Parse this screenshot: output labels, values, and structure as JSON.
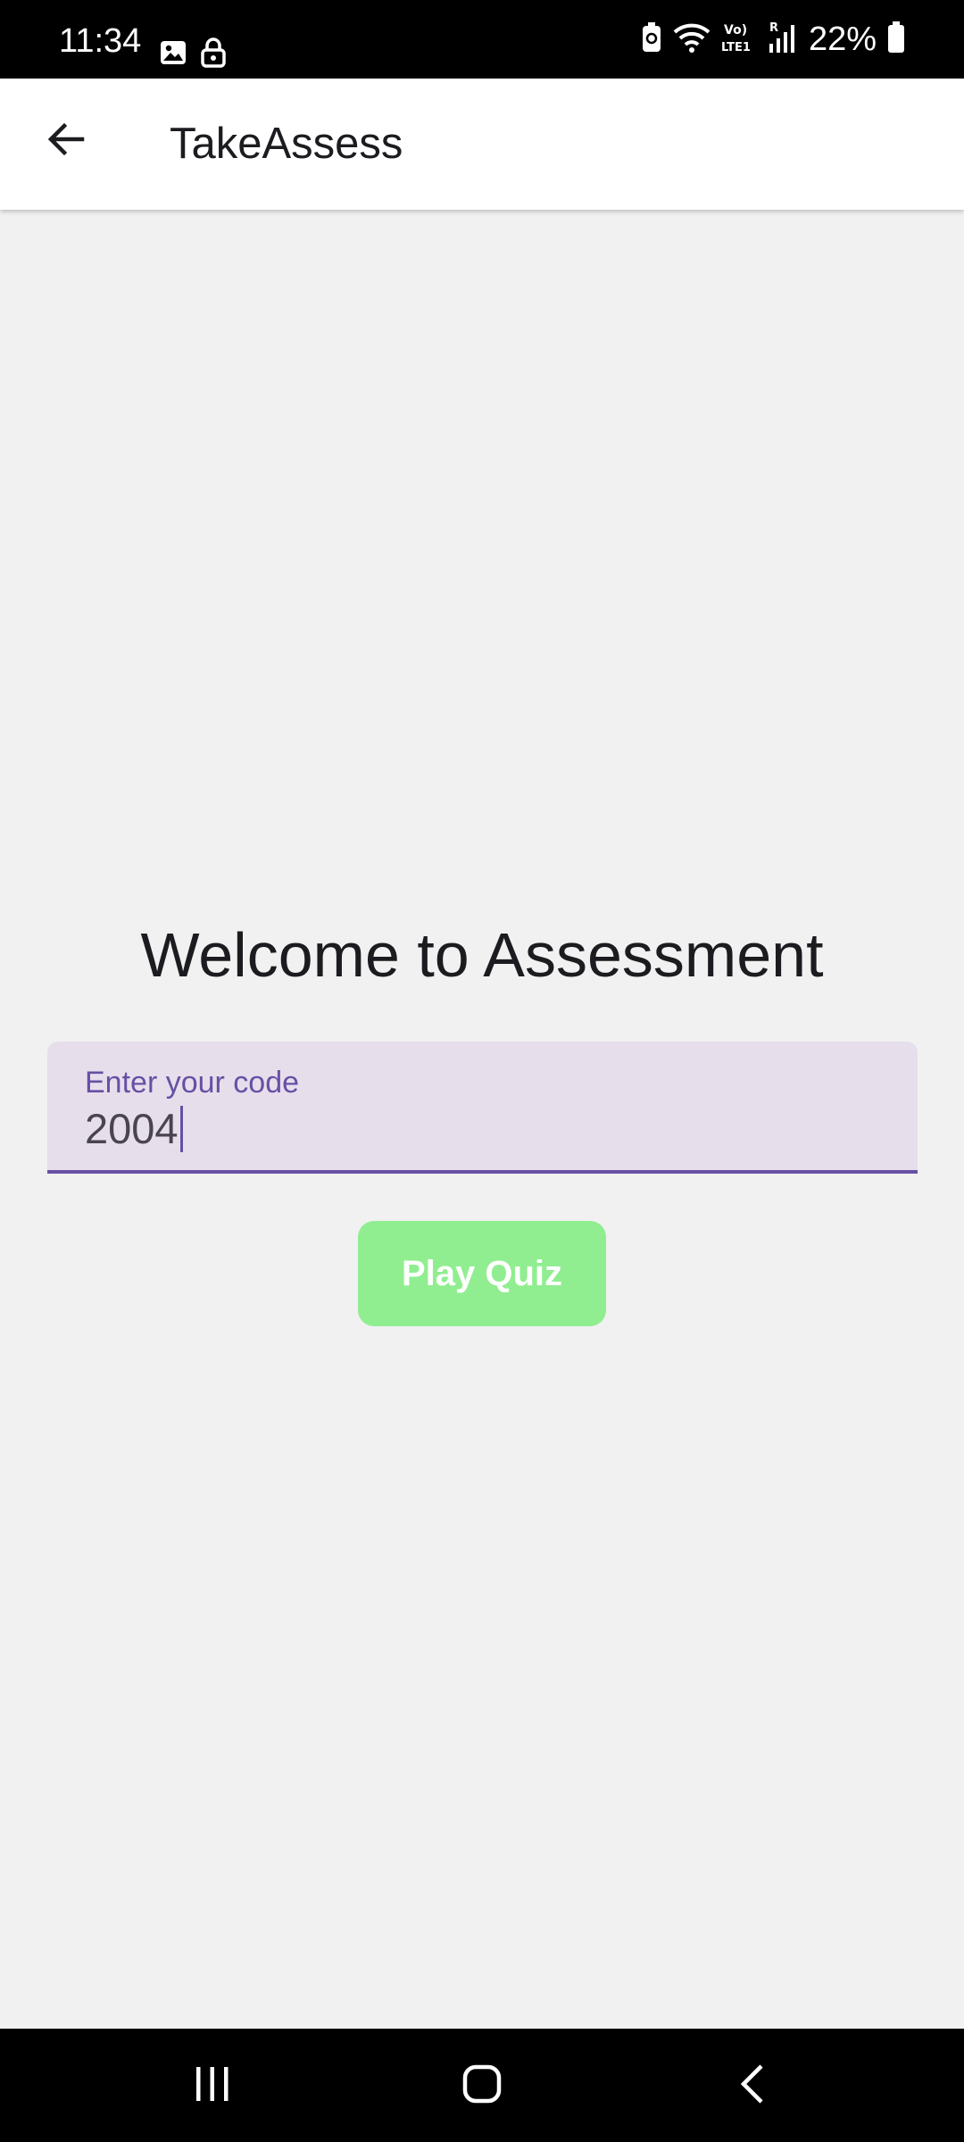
{
  "status_bar": {
    "time": "11:34",
    "battery": "22%"
  },
  "app_bar": {
    "title": "TakeAssess"
  },
  "main": {
    "welcome": "Welcome to Assessment",
    "code_field": {
      "label": "Enter your code",
      "value": "2004"
    },
    "play_button": "Play Quiz"
  },
  "colors": {
    "accent": "#6750a4",
    "field_bg": "#e7deec",
    "button_bg": "#90ee90",
    "page_bg": "#f1f1f1"
  },
  "icons": {
    "back": "arrow-left-icon",
    "recents": "recents-icon",
    "home": "home-icon",
    "nav_back": "chevron-left-icon"
  }
}
